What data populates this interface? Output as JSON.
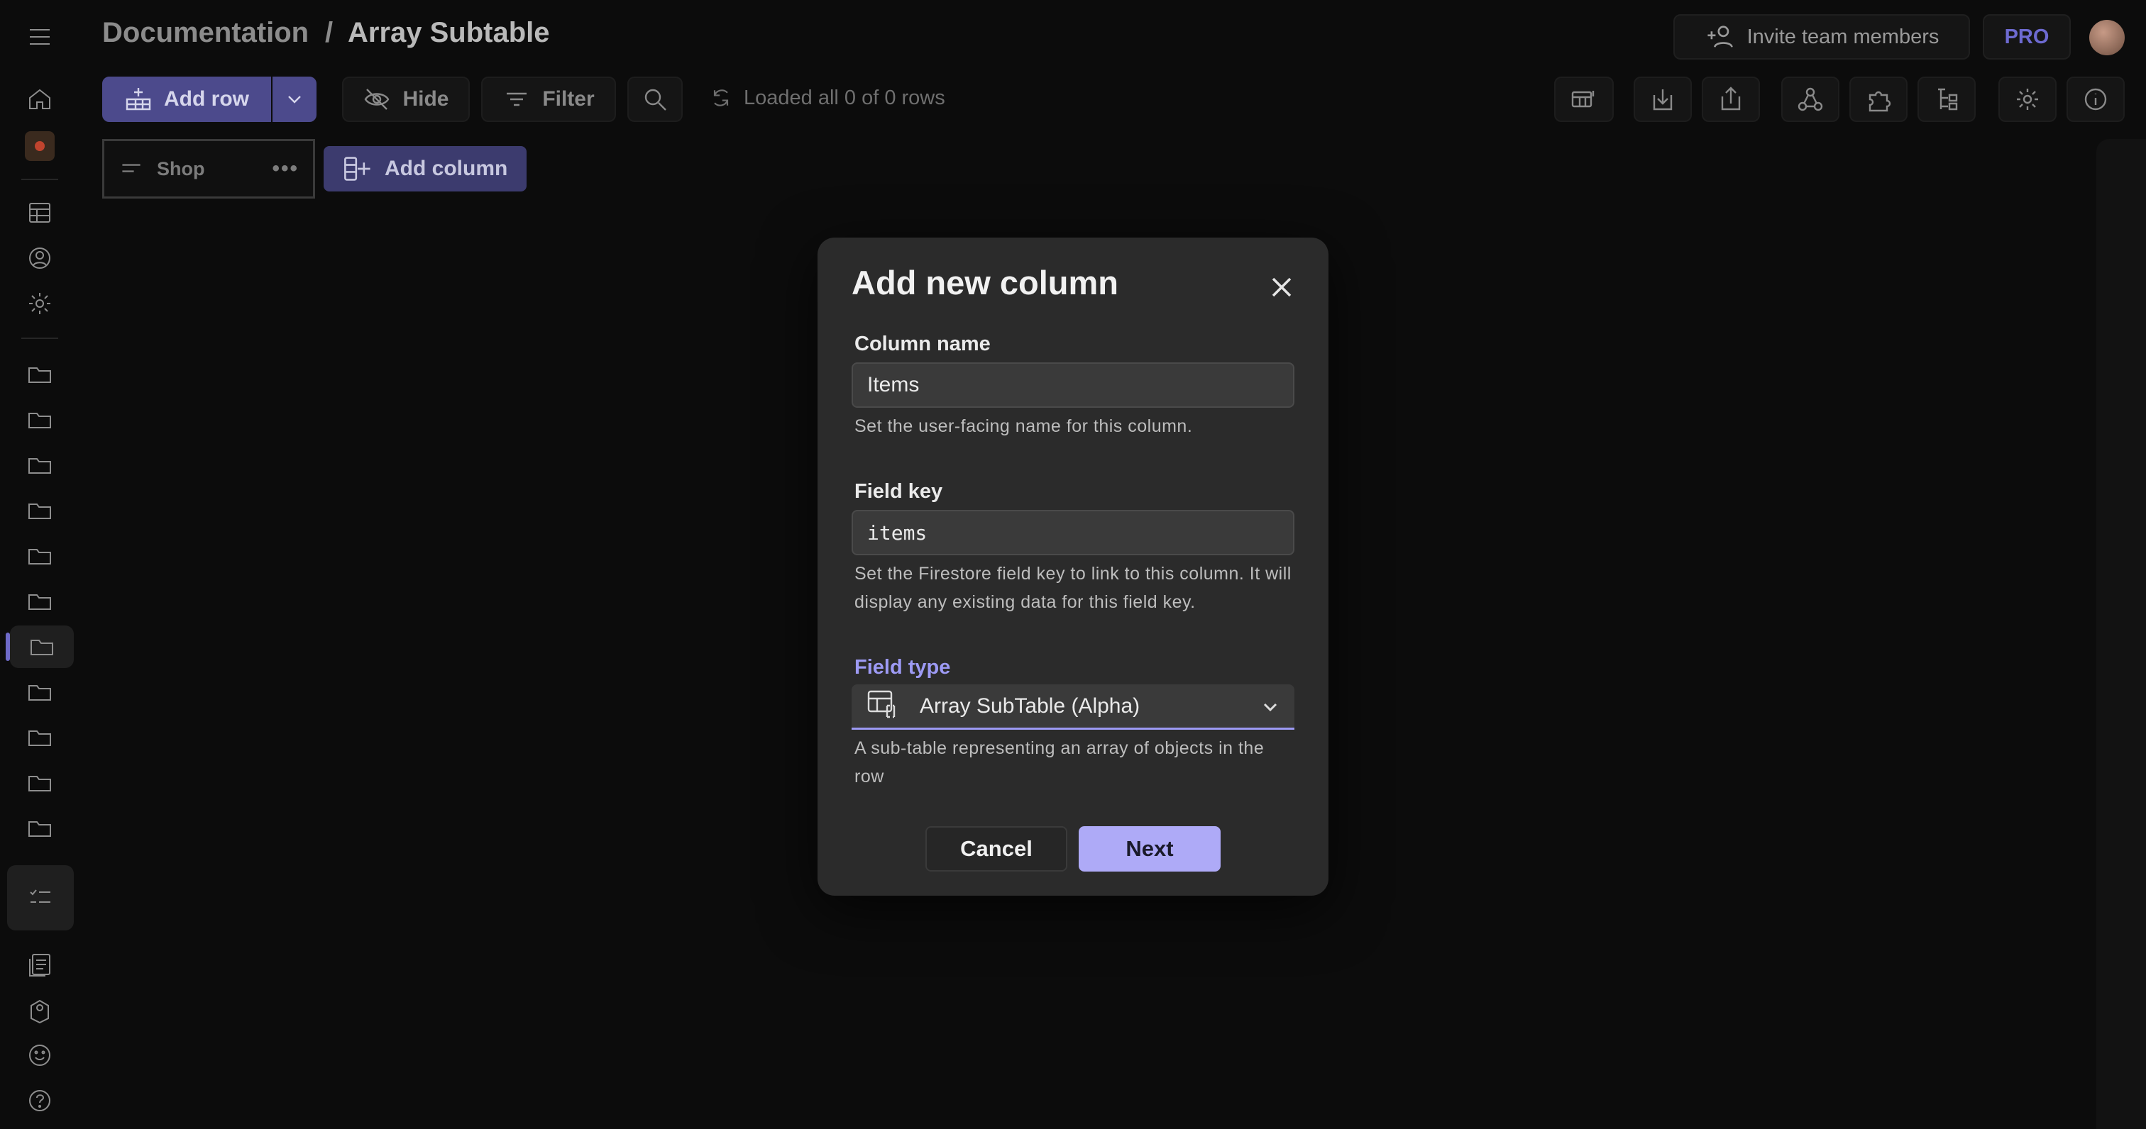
{
  "breadcrumb": {
    "parent": "Documentation",
    "separator": "/",
    "current": "Array Subtable"
  },
  "header": {
    "invite_label": "Invite team members",
    "pro_label": "PRO"
  },
  "toolbar": {
    "add_row_label": "Add row",
    "hide_label": "Hide",
    "filter_label": "Filter",
    "status_text": "Loaded all 0 of 0 rows"
  },
  "columns": {
    "shop_label": "Shop",
    "add_column_label": "Add column"
  },
  "dialog": {
    "title": "Add new column",
    "column_name_label": "Column name",
    "column_name_value": "Items",
    "column_name_help": "Set the user-facing name for this column.",
    "field_key_label": "Field key",
    "field_key_value": "items",
    "field_key_help": "Set the Firestore field key to link to this column. It will display any existing data for this field key.",
    "field_type_label": "Field type",
    "field_type_value": "Array SubTable (Alpha)",
    "field_type_help": "A sub-table representing an array of objects in the row",
    "cancel_label": "Cancel",
    "next_label": "Next"
  },
  "colors": {
    "accent": "#9d9af4",
    "primary_button": "#4c4a8c",
    "dialog_bg": "#2b2b2b",
    "page_bg": "#0c0c0c"
  }
}
